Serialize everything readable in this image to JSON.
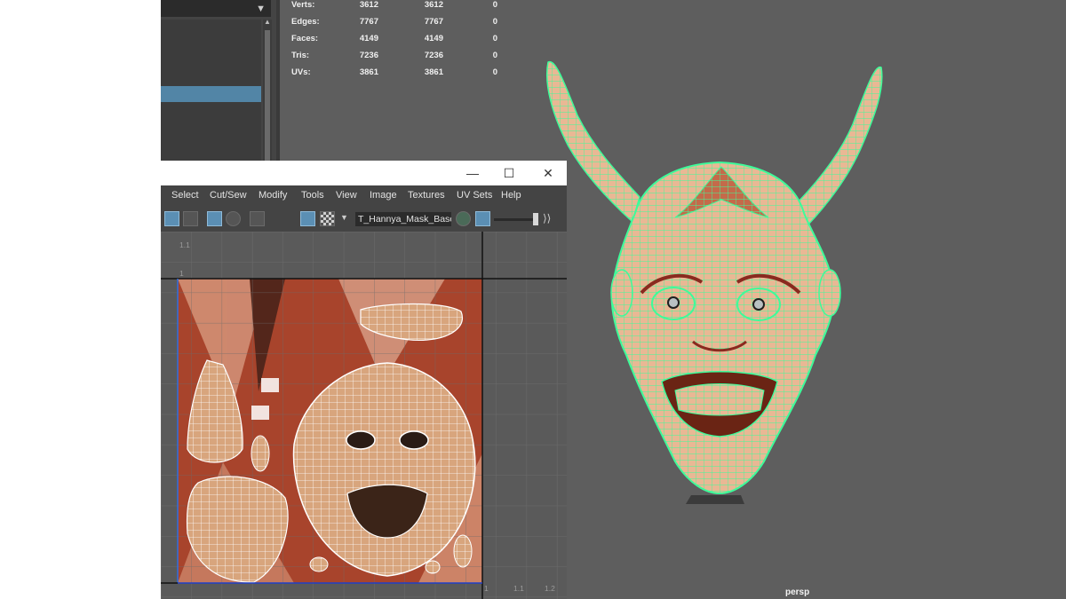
{
  "hud": {
    "rows": [
      {
        "label": "Verts:",
        "v1": "3612",
        "v2": "3612",
        "v3": "0"
      },
      {
        "label": "Edges:",
        "v1": "7767",
        "v2": "7767",
        "v3": "0"
      },
      {
        "label": "Faces:",
        "v1": "4149",
        "v2": "4149",
        "v3": "0"
      },
      {
        "label": "Tris:",
        "v1": "7236",
        "v2": "7236",
        "v3": "0"
      },
      {
        "label": "UVs:",
        "v1": "3861",
        "v2": "3861",
        "v3": "0"
      }
    ]
  },
  "uv_editor": {
    "window_controls": {
      "minimize": "—",
      "maximize": "☐",
      "close": "✕"
    },
    "menu": [
      "Select",
      "Cut/Sew",
      "Modify",
      "Tools",
      "View",
      "Image",
      "Textures",
      "UV Sets",
      "Help"
    ],
    "texture_field": "T_Hannya_Mask_Base",
    "slider_value": 0.9,
    "axis_labels": {
      "top_1_1": "1.1",
      "top_1": "1",
      "bottom_1": "1",
      "bottom_1_1": "1.1",
      "bottom_1_2": "1.2"
    }
  },
  "viewport": {
    "camera_label": "persp"
  },
  "colors": {
    "selection": "#5285a6",
    "wire_green": "#3dfc9a",
    "uv_white": "#ffffff",
    "skin": "#e9b894"
  }
}
